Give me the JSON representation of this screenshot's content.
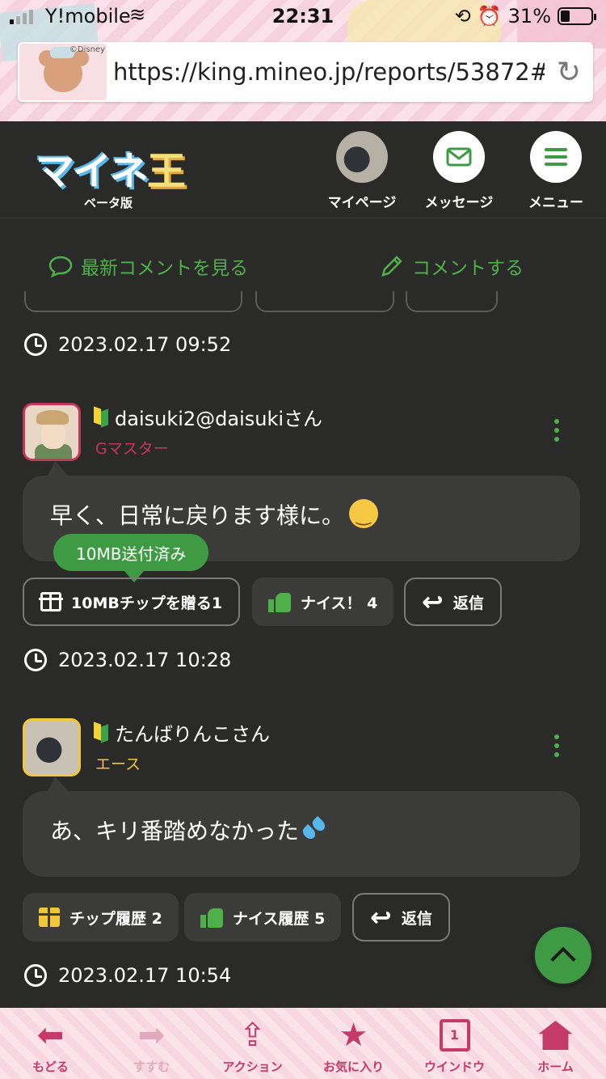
{
  "status_bar": {
    "carrier": "Y!mobile",
    "time": "22:31",
    "battery": "31%",
    "battery_level": 0.31
  },
  "browser": {
    "url": "https://king.mineo.jp/reports/53872#…",
    "thumbnail_credit": "©Disney"
  },
  "header": {
    "logo_text": "マイネ",
    "logo_tama": "王",
    "logo_sub": "ベータ版",
    "buttons": [
      {
        "label": "マイページ",
        "icon": "avatar-photo"
      },
      {
        "label": "メッセージ",
        "icon": "envelope-icon"
      },
      {
        "label": "メニュー",
        "icon": "hamburger-icon"
      }
    ]
  },
  "sub_actions": {
    "latest_comments": "最新コメントを見る",
    "write_comment": "コメントする"
  },
  "feed": {
    "timestamps": [
      "2023.02.17 09:52",
      "2023.02.17 10:28",
      "2023.02.17 10:54"
    ],
    "comments": [
      {
        "user": "daisuki2@daisukiさん",
        "rank": "Gマスター",
        "rank_color": "#c7355f",
        "text": "早く、日常に戻ります様に。",
        "tooltip": "10MB送付済み",
        "actions": {
          "chip": "10MBチップを贈る",
          "chip_count": "1",
          "nice": "ナイス！",
          "nice_count": "4",
          "reply": "返信"
        }
      },
      {
        "user": "たんばりんこさん",
        "rank": "エース",
        "rank_color": "#f0c63a",
        "text": "あ、キリ番踏めなかった",
        "actions": {
          "chip_history": "チップ履歴",
          "chip_history_count": "2",
          "nice_history": "ナイス履歴",
          "nice_history_count": "5",
          "reply": "返信"
        }
      }
    ]
  },
  "colors": {
    "accent_green": "#4fb04a",
    "background": "#2a2b29",
    "bubble": "#3b3c3a",
    "toolbar_pink": "#c43a68"
  },
  "toolbar": [
    {
      "label": "もどる",
      "icon": "back-arrow-icon",
      "enabled": true
    },
    {
      "label": "すすむ",
      "icon": "forward-arrow-icon",
      "enabled": false
    },
    {
      "label": "アクション",
      "icon": "share-icon",
      "enabled": true
    },
    {
      "label": "お気に入り",
      "icon": "star-icon",
      "enabled": true
    },
    {
      "label": "ウインドウ",
      "icon": "window-icon",
      "window_count": "1",
      "enabled": true
    },
    {
      "label": "ホーム",
      "icon": "home-icon",
      "enabled": true
    }
  ]
}
